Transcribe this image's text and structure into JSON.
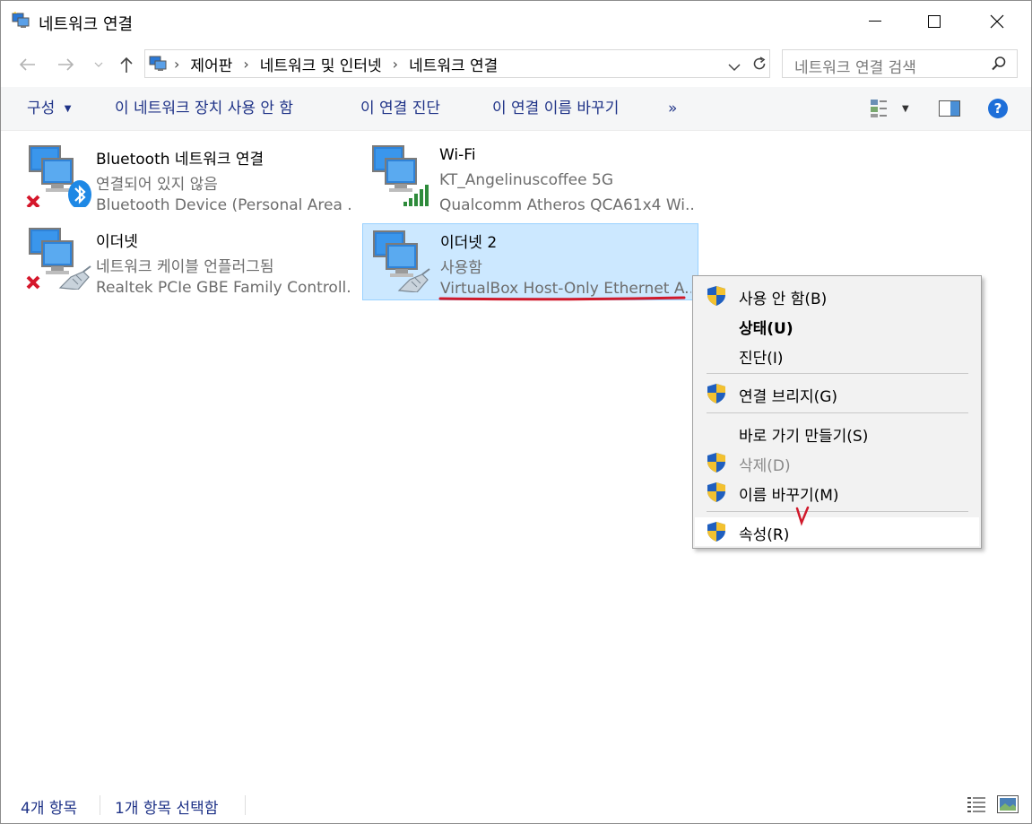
{
  "window": {
    "title": "네트워크 연결"
  },
  "address": {
    "crumbs": [
      "제어판",
      "네트워크 및 인터넷",
      "네트워크 연결"
    ],
    "search_placeholder": "네트워크 연결 검색"
  },
  "commands": {
    "organize": "구성",
    "disable_device": "이 네트워크 장치 사용 안 함",
    "diagnose": "이 연결 진단",
    "rename": "이 연결 이름 바꾸기",
    "more": "»"
  },
  "items": [
    {
      "name": "Bluetooth 네트워크 연결",
      "status": "연결되어 있지 않음",
      "device": "Bluetooth Device (Personal Area ...",
      "icon": "bluetooth-network-icon"
    },
    {
      "name": "Wi-Fi",
      "status": "KT_Angelinuscoffee 5G",
      "device": "Qualcomm Atheros QCA61x4 Wi...",
      "icon": "wifi-network-icon"
    },
    {
      "name": "이더넷",
      "status": "네트워크 케이블 언플러그됨",
      "device": "Realtek PCIe GBE Family Controll...",
      "icon": "ethernet-network-icon"
    },
    {
      "name": "이더넷 2",
      "status": "사용함",
      "device": "VirtualBox Host-Only Ethernet A...",
      "icon": "ethernet-network-icon"
    }
  ],
  "context_menu": {
    "items": [
      {
        "label": "사용 안 함(B)",
        "shield": true
      },
      {
        "label": "상태(U)",
        "bold": true
      },
      {
        "label": "진단(I)"
      },
      {
        "label": "연결 브리지(G)",
        "shield": true
      },
      {
        "label": "바로 가기 만들기(S)"
      },
      {
        "label": "삭제(D)",
        "shield": true,
        "disabled": true
      },
      {
        "label": "이름 바꾸기(M)",
        "shield": true
      },
      {
        "label": "속성(R)",
        "shield": true,
        "hovered": true
      }
    ]
  },
  "statusbar": {
    "count": "4개 항목",
    "selected": "1개 항목 선택함"
  },
  "colors": {
    "selection_bg": "#cce8ff",
    "selection_border": "#99d1ff",
    "annotation_red": "#d0192b",
    "link_blue": "#1e3287"
  }
}
